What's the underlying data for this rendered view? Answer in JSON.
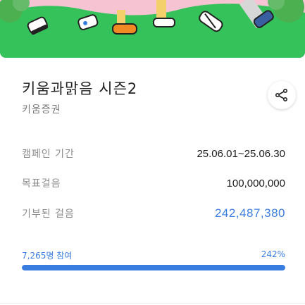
{
  "campaign": {
    "title": "키움과맑음 시즌2",
    "organization": "키움증권"
  },
  "details": [
    {
      "label": "캠페인 기간",
      "value": "25.06.01~25.06.30",
      "accent": false
    },
    {
      "label": "목표걸음",
      "value": "100,000,000",
      "accent": false
    },
    {
      "label": "기부된 걸음",
      "value": "242,487,380",
      "accent": true
    }
  ],
  "progress": {
    "participants_text": "7,265명 참여",
    "percent_text": "242%",
    "fill_fraction": 1.0
  },
  "icons": {
    "share": "share-icon",
    "banner": "walking-feet-illustration"
  },
  "colors": {
    "accent": "#3a7de0",
    "track": "#dbe6f7",
    "banner_sky": "#f7c7d6",
    "banner_grass": "#37c45a"
  }
}
